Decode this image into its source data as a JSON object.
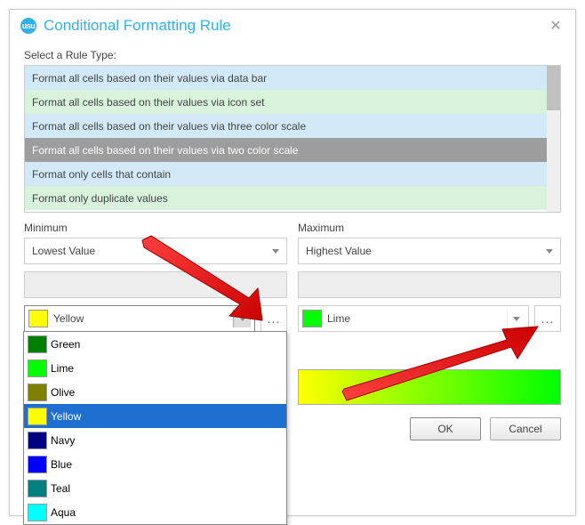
{
  "dialog": {
    "title": "Conditional Formatting Rule",
    "app_icon_text": "usu"
  },
  "rule_type": {
    "label": "Select a Rule Type:",
    "items": [
      "Format all cells based on their values via data bar",
      "Format all cells based on their values via icon set",
      "Format all cells based on their values via three color scale",
      "Format all cells based on their values via two color scale",
      "Format only cells that contain",
      "Format only duplicate values"
    ],
    "selected_index": 3
  },
  "minimum": {
    "label": "Minimum",
    "value_type": "Lowest Value",
    "color": {
      "name": "Yellow",
      "hex": "#ffff00"
    }
  },
  "maximum": {
    "label": "Maximum",
    "value_type": "Highest Value",
    "color": {
      "name": "Lime",
      "hex": "#00ff00"
    }
  },
  "color_options": [
    {
      "name": "Green",
      "hex": "#008000"
    },
    {
      "name": "Lime",
      "hex": "#00ff00"
    },
    {
      "name": "Olive",
      "hex": "#808000"
    },
    {
      "name": "Yellow",
      "hex": "#ffff00"
    },
    {
      "name": "Navy",
      "hex": "#000080"
    },
    {
      "name": "Blue",
      "hex": "#0000ff"
    },
    {
      "name": "Teal",
      "hex": "#008080"
    },
    {
      "name": "Aqua",
      "hex": "#00ffff"
    }
  ],
  "color_options_highlighted_index": 3,
  "more_label": "...",
  "buttons": {
    "ok": "OK",
    "cancel": "Cancel"
  },
  "preview": {
    "from": "#ffff00",
    "to": "#00ff00"
  }
}
